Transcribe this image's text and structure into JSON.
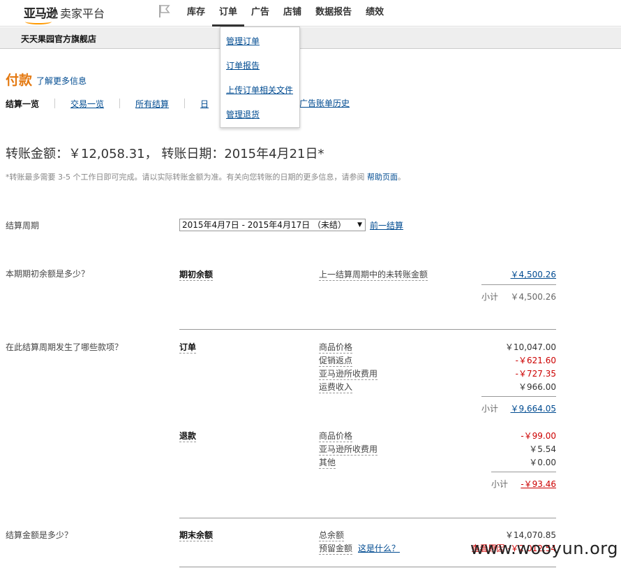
{
  "header": {
    "brand": "亚马逊",
    "subtitle": "卖家平台",
    "nav": [
      "库存",
      "订单",
      "广告",
      "店铺",
      "数据报告",
      "绩效"
    ]
  },
  "store": {
    "name": "天天果园官方旗舰店"
  },
  "dropdown": {
    "items": [
      "管理订单",
      "订单报告",
      "上传订单相关文件",
      "管理退货"
    ]
  },
  "page": {
    "title": "付款",
    "learn_more": "了解更多信息"
  },
  "subtabs": {
    "current": "结算一览",
    "items": [
      "交易一览",
      "所有结算",
      "日",
      "广告账单历史"
    ]
  },
  "transfer": {
    "text": "转账金额：￥12,058.31， 转账日期：2015年4月21日*",
    "note": "*转账最多需要 3-5 个工作日即可完成。请以实际转账金额为准。有关向您转账的日期的更多信息，请参阅",
    "help_link": "帮助页面",
    "note_end": "。"
  },
  "period": {
    "label": "结算周期",
    "value": "2015年4月7日 - 2015年4月17日 （未结）",
    "prev_link": "前一结算"
  },
  "opening": {
    "question": "本期期初余额是多少？",
    "heading": "期初余额",
    "line_label": "上一结算周期中的未转账金额",
    "line_amount": "￥4,500.26",
    "subtotal_label": "小计",
    "subtotal": "￥4,500.26"
  },
  "activity": {
    "question": "在此结算周期发生了哪些款项？",
    "orders": {
      "heading": "订单",
      "lines": [
        {
          "label": "商品价格",
          "amount": "￥10,047.00"
        },
        {
          "label": "促销返点",
          "amount": "-￥621.60"
        },
        {
          "label": "亚马逊所收费用",
          "amount": "-￥727.35"
        },
        {
          "label": "运费收入",
          "amount": "￥966.00"
        }
      ],
      "subtotal_label": "小计",
      "subtotal": "￥9,664.05"
    },
    "refunds": {
      "heading": "退款",
      "lines": [
        {
          "label": "商品价格",
          "amount": "-￥99.00"
        },
        {
          "label": "亚马逊所收费用",
          "amount": "￥5.54"
        },
        {
          "label": "其他",
          "amount": "￥0.00"
        }
      ],
      "subtotal_label": "小计",
      "subtotal": "-￥93.46"
    }
  },
  "closing": {
    "question": "结算金额是多少？",
    "heading": "期末余额",
    "total_label": "总余额",
    "total": "￥14,070.85",
    "reserve_label": "预留金额",
    "reserve_link": "这是什么？",
    "reserve_right": "查看原因 -￥2,012.54"
  },
  "watermark": "www.wooyun.org",
  "colors": {
    "accent": "#e47911",
    "link": "#004b91",
    "negative": "#cc0000"
  }
}
